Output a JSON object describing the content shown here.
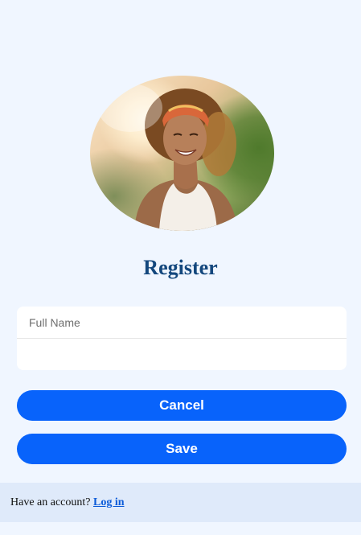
{
  "avatar": {
    "icon": "profile-photo"
  },
  "page": {
    "title": "Register"
  },
  "form": {
    "full_name": {
      "placeholder": "Full Name",
      "value": ""
    },
    "second_field": {
      "placeholder": "",
      "value": ""
    }
  },
  "buttons": {
    "cancel_label": "Cancel",
    "save_label": "Save"
  },
  "footer": {
    "prompt": "Have an account?",
    "login_label": "Log in"
  },
  "colors": {
    "background": "#f0f6ff",
    "primary": "#0863fb",
    "title": "#13477d",
    "footer_bg": "#dfeafa",
    "link": "#0a5ad8"
  }
}
